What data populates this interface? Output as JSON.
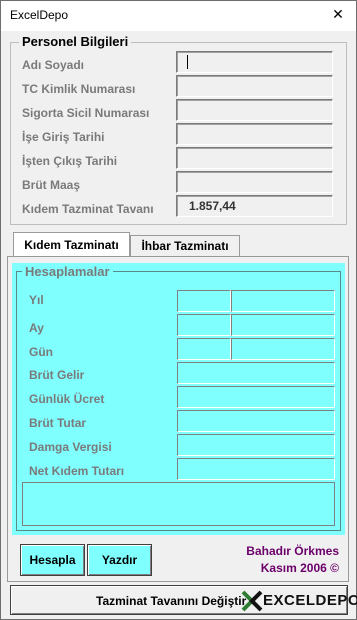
{
  "window": {
    "title": "ExcelDepo",
    "close_glyph": "✕"
  },
  "personel": {
    "legend": "Personel Bilgileri",
    "fields": [
      {
        "label": "Adı Soyadı",
        "value": ""
      },
      {
        "label": "TC Kimlik Numarası",
        "value": ""
      },
      {
        "label": "Sigorta Sicil Numarası",
        "value": ""
      },
      {
        "label": "İşe Giriş Tarihi",
        "value": ""
      },
      {
        "label": "İşten Çıkış Tarihi",
        "value": ""
      },
      {
        "label": "Brüt Maaş",
        "value": ""
      },
      {
        "label": "Kıdem Tazminat Tavanı",
        "value": "1.857,44"
      }
    ]
  },
  "tabs": [
    {
      "label": "Kıdem Tazminatı",
      "active": true
    },
    {
      "label": "İhbar Tazminatı",
      "active": false
    }
  ],
  "hesap": {
    "legend": "Hesaplamalar",
    "rows": [
      {
        "label": "Yıl"
      },
      {
        "label": "Ay"
      },
      {
        "label": "Gün"
      },
      {
        "label": "Brüt Gelir"
      },
      {
        "label": "Günlük Ücret"
      },
      {
        "label": "Brüt Tutar"
      },
      {
        "label": "Damga Vergisi"
      },
      {
        "label": "Net Kıdem Tutarı"
      }
    ]
  },
  "buttons": {
    "hesapla": "Hesapla",
    "yazdir": "Yazdır",
    "tavan": "Tazminat Tavanını Değiştir"
  },
  "credit": {
    "name": "Bahadır Örkmes",
    "date": "Kasım 2006 ©"
  },
  "logo": {
    "text": "EXCELDEPO"
  },
  "colors": {
    "accent": "#80ffff",
    "credit": "#6b006b"
  }
}
